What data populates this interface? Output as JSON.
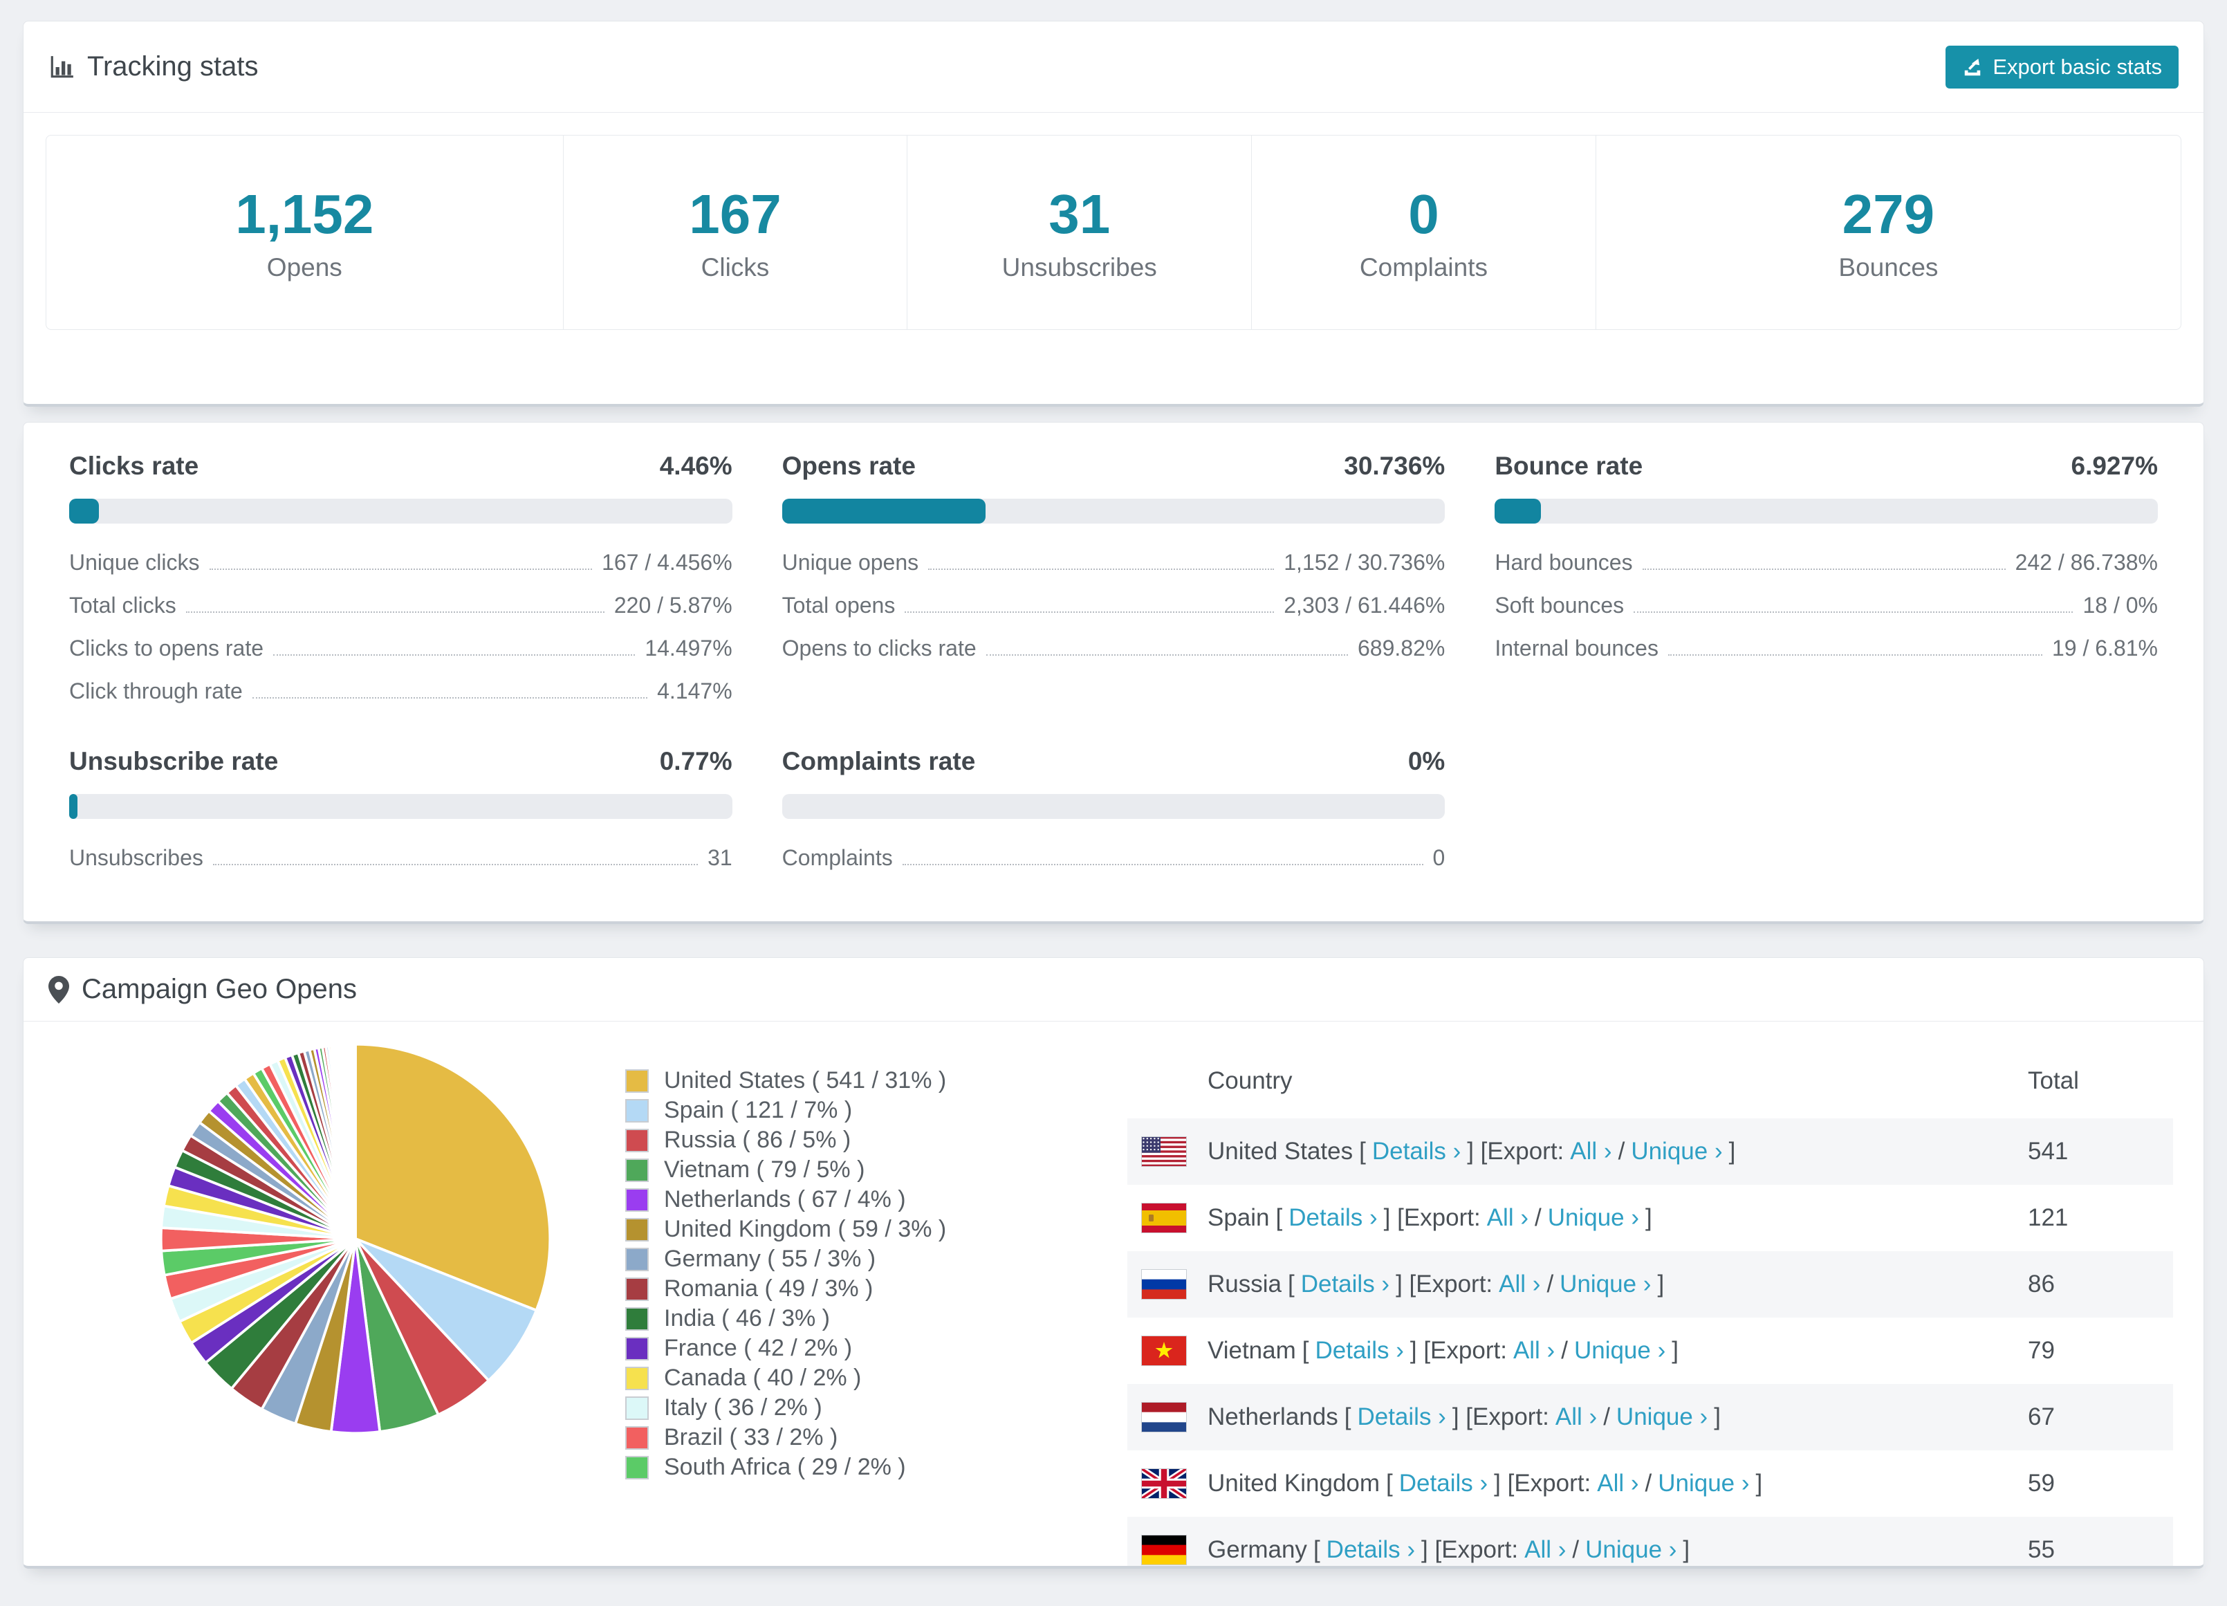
{
  "colors": {
    "accent_teal": "#1789a1",
    "button_teal": "#1791a9",
    "link_blue": "#2f9fc4",
    "bar_track": "#e9ebef",
    "row_alt_bg": "#f5f6f8",
    "page_bg": "#eef0f3"
  },
  "header": {
    "title": "Tracking stats",
    "export_label": "Export basic stats"
  },
  "stats": [
    {
      "value": "1,152",
      "label": "Opens"
    },
    {
      "value": "167",
      "label": "Clicks"
    },
    {
      "value": "31",
      "label": "Unsubscribes"
    },
    {
      "value": "0",
      "label": "Complaints"
    },
    {
      "value": "279",
      "label": "Bounces"
    }
  ],
  "rates": [
    {
      "title": "Clicks rate",
      "value": "4.46%",
      "percent": 4.46,
      "rows": [
        {
          "label": "Unique clicks",
          "value": "167 / 4.456%"
        },
        {
          "label": "Total clicks",
          "value": "220 / 5.87%"
        },
        {
          "label": "Clicks to opens rate",
          "value": "14.497%"
        },
        {
          "label": "Click through rate",
          "value": "4.147%"
        }
      ]
    },
    {
      "title": "Opens rate",
      "value": "30.736%",
      "percent": 30.736,
      "rows": [
        {
          "label": "Unique opens",
          "value": "1,152 / 30.736%"
        },
        {
          "label": "Total opens",
          "value": "2,303 / 61.446%"
        },
        {
          "label": "Opens to clicks rate",
          "value": "689.82%"
        }
      ]
    },
    {
      "title": "Bounce rate",
      "value": "6.927%",
      "percent": 6.927,
      "rows": [
        {
          "label": "Hard bounces",
          "value": "242 / 86.738%"
        },
        {
          "label": "Soft bounces",
          "value": "18 / 0%"
        },
        {
          "label": "Internal bounces",
          "value": "19 / 6.81%"
        }
      ]
    },
    {
      "title": "Unsubscribe rate",
      "value": "0.77%",
      "percent": 0.77,
      "rows": [
        {
          "label": "Unsubscribes",
          "value": "31"
        }
      ]
    },
    {
      "title": "Complaints rate",
      "value": "0%",
      "percent": 0,
      "rows": [
        {
          "label": "Complaints",
          "value": "0"
        }
      ]
    }
  ],
  "chart_data": {
    "type": "pie",
    "title": "Campaign Geo Opens",
    "legend_position": "right",
    "start_angle_deg": 0,
    "clockwise": true,
    "slices": [
      {
        "label": "United States",
        "value": 541,
        "pct": 31,
        "color": "#e5bb44",
        "legend_label": "United States ( 541 / 31% )"
      },
      {
        "label": "Spain",
        "value": 121,
        "pct": 7,
        "color": "#b4d9f5",
        "legend_label": "Spain ( 121 / 7% )"
      },
      {
        "label": "Russia",
        "value": 86,
        "pct": 5,
        "color": "#cf4b50",
        "legend_label": "Russia ( 86 / 5% )"
      },
      {
        "label": "Vietnam",
        "value": 79,
        "pct": 5,
        "color": "#4fa85a",
        "legend_label": "Vietnam ( 79 / 5% )"
      },
      {
        "label": "Netherlands",
        "value": 67,
        "pct": 4,
        "color": "#9a3df0",
        "legend_label": "Netherlands ( 67 / 4% )"
      },
      {
        "label": "United Kingdom",
        "value": 59,
        "pct": 3,
        "color": "#b5922f",
        "legend_label": "United Kingdom ( 59 / 3% )"
      },
      {
        "label": "Germany",
        "value": 55,
        "pct": 3,
        "color": "#8ca9c9",
        "legend_label": "Germany ( 55 / 3% )"
      },
      {
        "label": "Romania",
        "value": 49,
        "pct": 3,
        "color": "#a63d42",
        "legend_label": "Romania ( 49 / 3% )"
      },
      {
        "label": "India",
        "value": 46,
        "pct": 3,
        "color": "#2f7d3b",
        "legend_label": "India ( 46 / 3% )"
      },
      {
        "label": "France",
        "value": 42,
        "pct": 2,
        "color": "#6a2fc0",
        "legend_label": "France ( 42 / 2% )"
      },
      {
        "label": "Canada",
        "value": 40,
        "pct": 2,
        "color": "#f6e14e",
        "legend_label": "Canada ( 40 / 2% )"
      },
      {
        "label": "Italy",
        "value": 36,
        "pct": 2,
        "color": "#dcf8f8",
        "legend_label": "Italy ( 36 / 2% )"
      },
      {
        "label": "Brazil",
        "value": 33,
        "pct": 2,
        "color": "#f26060",
        "legend_label": "Brazil ( 33 / 2% )"
      },
      {
        "label": "South Africa",
        "value": 29,
        "pct": 2,
        "color": "#5bcb67",
        "legend_label": "South Africa ( 29 / 2% )"
      }
    ],
    "others_pct": [
      1.9,
      1.8,
      1.7,
      1.6,
      1.5,
      1.4,
      1.3,
      1.2,
      1.1,
      1.0,
      0.95,
      0.9,
      0.85,
      0.8,
      0.75,
      0.7,
      0.65,
      0.6,
      0.55,
      0.5,
      0.45,
      0.4,
      0.36,
      0.32,
      0.28,
      0.25,
      0.22,
      0.19,
      0.16,
      0.14,
      0.12,
      0.1,
      0.08,
      0.07,
      0.06,
      0.05,
      0.2,
      0.18,
      0.15,
      0.12,
      0.1,
      0.09,
      0.08,
      0.05,
      0.03
    ]
  },
  "geo": {
    "title": "Campaign Geo Opens",
    "table": {
      "header": {
        "country": "Country",
        "total": "Total"
      },
      "link_text": {
        "p1": "[",
        "details": "Details ›",
        "p2": "] [Export:",
        "all": "All ›",
        "p3": "/",
        "unique": "Unique ›",
        "p4": "]"
      },
      "rows": [
        {
          "country": "United States",
          "total": "541",
          "flag": "us"
        },
        {
          "country": "Spain",
          "total": "121",
          "flag": "es"
        },
        {
          "country": "Russia",
          "total": "86",
          "flag": "ru"
        },
        {
          "country": "Vietnam",
          "total": "79",
          "flag": "vn"
        },
        {
          "country": "Netherlands",
          "total": "67",
          "flag": "nl"
        },
        {
          "country": "United Kingdom",
          "total": "59",
          "flag": "gb"
        },
        {
          "country": "Germany",
          "total": "55",
          "flag": "de"
        }
      ]
    },
    "flags": {
      "us": {
        "kind": "us"
      },
      "es": {
        "kind": "stripes",
        "colors": [
          "#C8102E",
          "#F1BF00",
          "#C8102E"
        ],
        "ratios": [
          1,
          2,
          1
        ],
        "emblem": true
      },
      "ru": {
        "kind": "stripes",
        "colors": [
          "#ffffff",
          "#0039a6",
          "#d52b1e"
        ],
        "ratios": [
          1,
          1,
          1
        ]
      },
      "vn": {
        "kind": "star",
        "bg": "#da251d",
        "star": "#ffed00"
      },
      "nl": {
        "kind": "stripes",
        "colors": [
          "#ae1c28",
          "#ffffff",
          "#21468b"
        ],
        "ratios": [
          1,
          1,
          1
        ]
      },
      "gb": {
        "kind": "uk",
        "bg": "#012169",
        "cross": "#C8102E"
      },
      "de": {
        "kind": "stripes",
        "colors": [
          "#000000",
          "#dd0000",
          "#ffce00"
        ],
        "ratios": [
          1,
          1,
          1
        ]
      }
    }
  }
}
